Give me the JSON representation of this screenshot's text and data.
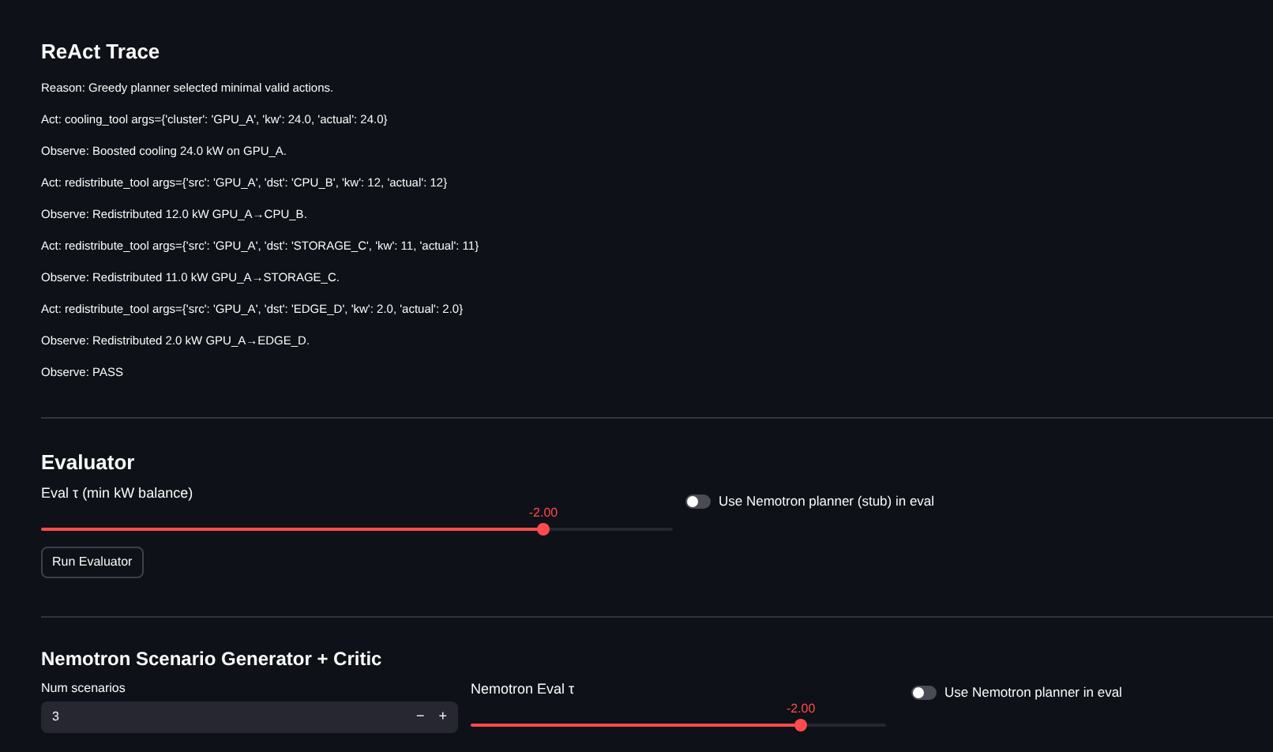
{
  "trace": {
    "title": "ReAct Trace",
    "lines": [
      "Reason: Greedy planner selected minimal valid actions.",
      "Act: cooling_tool args={'cluster': 'GPU_A', 'kw': 24.0, 'actual': 24.0}",
      "Observe: Boosted cooling 24.0 kW on GPU_A.",
      "Act: redistribute_tool args={'src': 'GPU_A', 'dst': 'CPU_B', 'kw': 12, 'actual': 12}",
      "Observe: Redistributed 12.0 kW GPU_A→CPU_B.",
      "Act: redistribute_tool args={'src': 'GPU_A', 'dst': 'STORAGE_C', 'kw': 11, 'actual': 11}",
      "Observe: Redistributed 11.0 kW GPU_A→STORAGE_C.",
      "Act: redistribute_tool args={'src': 'GPU_A', 'dst': 'EDGE_D', 'kw': 2.0, 'actual': 2.0}",
      "Observe: Redistributed 2.0 kW GPU_A→EDGE_D.",
      "Observe: PASS"
    ]
  },
  "evaluator": {
    "title": "Evaluator",
    "slider": {
      "label": "Eval τ (min kW balance)",
      "reading": "-2.00",
      "level": 0.795
    },
    "toggle": {
      "label": "Use Nemotron planner (stub) in eval",
      "on": false
    },
    "button": "Run Evaluator"
  },
  "generator": {
    "title": "Nemotron Scenario Generator + Critic",
    "num": {
      "label": "Num scenarios",
      "value": "3",
      "minus": "−",
      "plus": "+"
    },
    "slider": {
      "label": "Nemotron Eval τ",
      "reading": "-2.00",
      "level": 0.795
    },
    "toggle": {
      "label": "Use Nemotron planner in eval",
      "on": false
    }
  }
}
